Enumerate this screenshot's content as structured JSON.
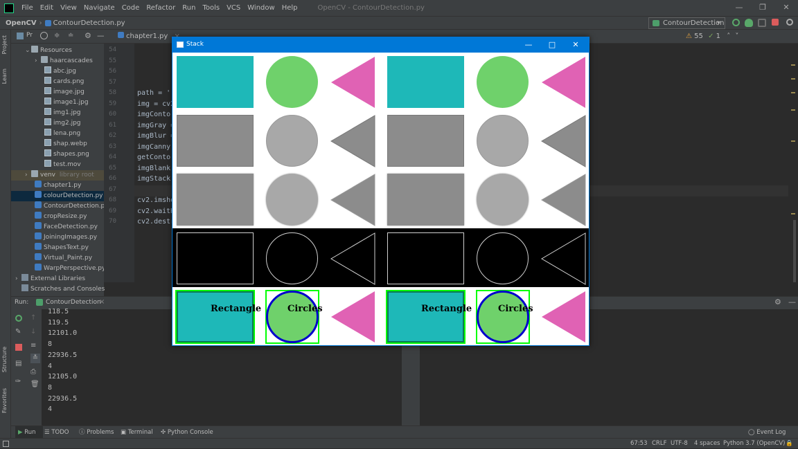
{
  "ide": {
    "menu": [
      "File",
      "Edit",
      "View",
      "Navigate",
      "Code",
      "Refactor",
      "Run",
      "Tools",
      "VCS",
      "Window",
      "Help"
    ],
    "window_title": "OpenCV - ContourDetection.py",
    "breadcrumb_project": "OpenCV",
    "breadcrumb_file": "ContourDetection.py",
    "run_config": "ContourDetection",
    "project_panel_label": "Project",
    "project_dropdown": "Pr",
    "learn_label": "Learn",
    "structure_label": "Structure",
    "favorites_label": "Favorites",
    "tree": [
      {
        "label": "Resources",
        "type": "folder",
        "indent": 1
      },
      {
        "label": "haarcascades",
        "type": "folder",
        "indent": 2
      },
      {
        "label": "abc.jpg",
        "type": "img",
        "indent": 3
      },
      {
        "label": "cards.png",
        "type": "img",
        "indent": 3
      },
      {
        "label": "image.jpg",
        "type": "img",
        "indent": 3
      },
      {
        "label": "image1.jpg",
        "type": "img",
        "indent": 3
      },
      {
        "label": "img1.jpg",
        "type": "img",
        "indent": 3
      },
      {
        "label": "img2.jpg",
        "type": "img",
        "indent": 3
      },
      {
        "label": "lena.png",
        "type": "img",
        "indent": 3
      },
      {
        "label": "shap.webp",
        "type": "img",
        "indent": 3
      },
      {
        "label": "shapes.png",
        "type": "img",
        "indent": 3
      },
      {
        "label": "test.mov",
        "type": "img",
        "indent": 3
      },
      {
        "label": "venv",
        "type": "folder",
        "indent": 1,
        "hint": "library root"
      },
      {
        "label": "chapter1.py",
        "type": "py",
        "indent": 2
      },
      {
        "label": "colourDetection.py",
        "type": "py",
        "indent": 2,
        "selected": true
      },
      {
        "label": "ContourDetection.p",
        "type": "py",
        "indent": 2
      },
      {
        "label": "cropResize.py",
        "type": "py",
        "indent": 2
      },
      {
        "label": "FaceDetection.py",
        "type": "py",
        "indent": 2
      },
      {
        "label": "JoiningImages.py",
        "type": "py",
        "indent": 2
      },
      {
        "label": "ShapesText.py",
        "type": "py",
        "indent": 2
      },
      {
        "label": "Virtual_Paint.py",
        "type": "py",
        "indent": 2
      },
      {
        "label": "WarpPerspective.py",
        "type": "py",
        "indent": 2
      },
      {
        "label": "External Libraries",
        "type": "lib",
        "indent": 0
      },
      {
        "label": "Scratches and Consoles",
        "type": "lib",
        "indent": 0
      }
    ],
    "tabs": [
      "chapter1.py"
    ],
    "inspection": {
      "warnings": "55",
      "weak": "1"
    },
    "line_numbers": [
      "54",
      "55",
      "56",
      "57",
      "58",
      "59",
      "60",
      "61",
      "62",
      "63",
      "64",
      "65",
      "66",
      "67",
      "68",
      "69",
      "70"
    ],
    "code_lines": [
      "",
      "",
      "",
      "",
      "path = '",
      "img = cv2",
      "imgConto",
      "imgGray =",
      "imgBlur =",
      "imgCanny",
      "getConto",
      "imgBlank",
      "imgStack",
      "",
      "cv2.imsho",
      "cv2.waitK",
      "cv2.destr"
    ],
    "run_label": "Run:",
    "run_tab": "ContourDetection",
    "output": [
      "118.5",
      "119.5",
      "12101.0",
      "8",
      "22936.5",
      "4",
      "12105.0",
      "8",
      "22936.5",
      "4"
    ],
    "bottom_tabs": [
      "Run",
      "TODO",
      "Problems",
      "Terminal",
      "Python Console"
    ],
    "event_log": "Event Log",
    "status": {
      "position": "67:53",
      "line_sep": "CRLF",
      "encoding": "UTF-8",
      "indent": "4 spaces",
      "interpreter": "Python 3.7 (OpenCV)"
    }
  },
  "stack_window": {
    "title": "Stack",
    "labels": {
      "rect": "Rectangle",
      "circle": "Circles"
    }
  },
  "colors": {
    "teal": "#1eb8b8",
    "green": "#6fd16b",
    "pink": "#e062b4",
    "gray_dark": "#8c8c8c",
    "gray_light": "#a8a8a8",
    "contour_green": "#00ff00",
    "contour_blue": "#0000cc",
    "accent": "#0078d7"
  }
}
